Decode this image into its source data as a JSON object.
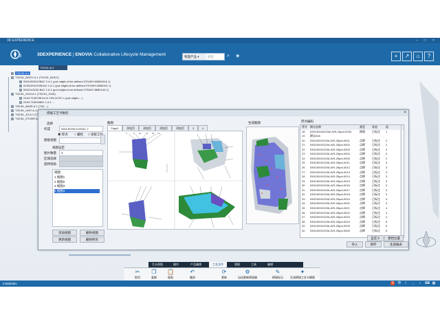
{
  "window": {
    "title": "3D EXPERIENCE",
    "controls": "– □ ×"
  },
  "app": {
    "logo": "3ds-compass-icon",
    "brand_bold": "3DEXPERIENCE",
    "brand_sep": " | ",
    "brand_product": "ENOVIA",
    "brand_rest": " Collaborative Lifecycle Management",
    "search_scope": "物理产品 ▾",
    "search_placeholder": "搜索"
  },
  "tree": {
    "tab": "T33 B1 ALT",
    "items": [
      {
        "label": "T33 B1 A.1",
        "selected": true
      },
      {
        "label": "T33-B1_BODY A.1 (T33 B1_BODY)"
      },
      {
        "label": "5301000KG2BAC 2 A.1 (prd-mfgflo-bi.be.defined 0704WY-88801616 1)"
      },
      {
        "label": "5130100UGHB1AC 2 A.1 (prd-mfgflo-bi.be.defined 0704WY-8880161 1)"
      },
      {
        "label": "5462143100-B4C 2 A.1 (prd-mfgflo-bi.be.defined 0704WY-8880144 1)"
      },
      {
        "label": "T33 B1_GUN A.1 (T33 B1_GUN)"
      },
      {
        "label": "GUN-T12879E1A 01 HFL04 RC 1 (prd-mfgflo-...)"
      },
      {
        "label": "GUN-T18918801 1 A.1 ..."
      },
      {
        "label": "T33 B1_BASE A.1 (T33 ...)"
      },
      {
        "label": "T33 B1_UNIT A.1 (T33 ...)"
      },
      {
        "label": "T33 B1_JO A.1 (T33 ...)"
      },
      {
        "label": "T33 B1_OTHER A.1 (T33 ...)"
      }
    ]
  },
  "dialog": {
    "title": "焊接工艺卡制作",
    "select_section": "选择",
    "process_label": "作成",
    "process_value": "53013000KG24SAC 2",
    "radio1": "焊点",
    "radio2": "螺栓",
    "radio3": "涂胶工位",
    "sheet_label": "图纸视图",
    "view_settings": "视图设定",
    "view_count_label": "图片数量",
    "view_count_value": "4",
    "area_label": "区域选择",
    "rotate_label": "旋转视角",
    "views_list_header": "视图",
    "views": [
      "1   视图1",
      "2   视图2",
      "3   视图3",
      "4   视图4"
    ],
    "selected_view_index": 3,
    "btn_add_view": "添加视图",
    "btn_delete_view": "删除视图",
    "btn_update_view": "更新视图",
    "btn_delete_all": "删除所有",
    "drawing_section": "截图",
    "page_tabs": [
      "Page1",
      "添加页",
      "添加页",
      "添加页",
      "添加页",
      "3",
      "4"
    ],
    "preview_section": "生成截图",
    "table_section": "焊点编码",
    "table": {
      "headers": [
        "序号",
        "焊点名称",
        "类型",
        "状态",
        "组"
      ],
      "rows": [
        [
          "18",
          "5301300X6G20A-WS-25pot-0030",
          "焊透",
          "已标注",
          "1"
        ],
        [
          "19",
          "焊点248",
          "",
          "",
          ""
        ],
        [
          "20",
          "5301300XG20A-WS-25pot-0001",
          "点焊",
          "已标注",
          "2"
        ],
        [
          "21",
          "5301300XG20A-WS-25pot-0002",
          "点焊",
          "已标注",
          "2"
        ],
        [
          "22",
          "5301300XG20A-WS-25pot-0003",
          "点焊",
          "已标注",
          "2"
        ],
        [
          "23",
          "5301300XG20A-WS-25pot-0004",
          "点焊",
          "已标注",
          "2"
        ],
        [
          "24",
          "5301300XG20A-WS-25pot-0005",
          "点焊",
          "已标注",
          "2"
        ],
        [
          "25",
          "5301300XG20A-WS-25pot-0011",
          "点焊",
          "已标注",
          "3"
        ],
        [
          "26",
          "5301300XG20A-WS-25pot-0012",
          "点焊",
          "已标注",
          "3"
        ],
        [
          "27",
          "5301300XG20A-WS-25pot-0013",
          "点焊",
          "已标注",
          "3"
        ],
        [
          "28",
          "5301300XG20A-WS-25pot-0014",
          "点焊",
          "已标注",
          "3"
        ],
        [
          "29",
          "5301300XG20A-WS-25pot-0015",
          "点焊",
          "已标注",
          "3"
        ],
        [
          "30",
          "5301300XG20A-WS-25pot-0016",
          "点焊",
          "已标注",
          "3"
        ],
        [
          "31",
          "5301300XG20A-WS-25pot-0017",
          "点焊",
          "已标注",
          "3"
        ],
        [
          "32",
          "5301300XG20A-WS-25pot-0018",
          "点焊",
          "已标注",
          "3"
        ],
        [
          "33",
          "5301300XG20A-WS-25pot-0019",
          "点焊",
          "已标注",
          "4"
        ],
        [
          "34",
          "5301300XG20A-WS-25pot-0020",
          "点焊",
          "已标注",
          "4"
        ],
        [
          "35",
          "5301300XG20A-WS-25pot-0021",
          "点焊",
          "已标注",
          "4"
        ],
        [
          "36",
          "5301300XG20A-WS-25pot-0022",
          "点焊",
          "已标注",
          "4"
        ],
        [
          "37",
          "5301300XG20A-WS-25pot-0023",
          "点焊",
          "已标注",
          "4"
        ],
        [
          "38",
          "5301300XG20A-WS-25pot-0024",
          "点焊",
          "已标注",
          "5"
        ],
        [
          "39",
          "5301300XG20A-WS-25pot-0025",
          "点焊",
          "已标注",
          "5"
        ],
        [
          "40",
          "5301300XG20A-WS-25pot-0026",
          "点焊",
          "已标注",
          "5"
        ]
      ]
    },
    "btn_export": "导入",
    "btn_save": "保存",
    "btn_rename": "自定义",
    "btn_map": "建档位置",
    "btn_generate": "生成报表"
  },
  "action_bar": {
    "tabs": [
      "生长视图",
      "操作",
      "产品编辑",
      "工艺文件",
      "视图",
      "工具",
      "编辑"
    ],
    "active_tab_index": 3,
    "items": [
      {
        "label": "剪切",
        "icon": "scissors-icon"
      },
      {
        "label": "复制",
        "icon": "copy-icon"
      },
      {
        "label": "粘贴",
        "icon": "paste-icon"
      },
      {
        "label": "撤消",
        "icon": "undo-icon"
      },
      {
        "label": "更新",
        "icon": "update-icon"
      },
      {
        "label": "自动更新焊接端",
        "icon": "auto-update-icon"
      },
      {
        "label": "焊接标记",
        "icon": "weld-mark-icon"
      },
      {
        "label": "生成焊接工艺卡模版",
        "icon": "weld-card-icon"
      }
    ]
  },
  "status_bar": {
    "text": "InitialDialo"
  },
  "colors": {
    "brand_blue": "#1e6aa8",
    "dark_blue": "#1b5e97",
    "selection": "#2f6fd1"
  }
}
